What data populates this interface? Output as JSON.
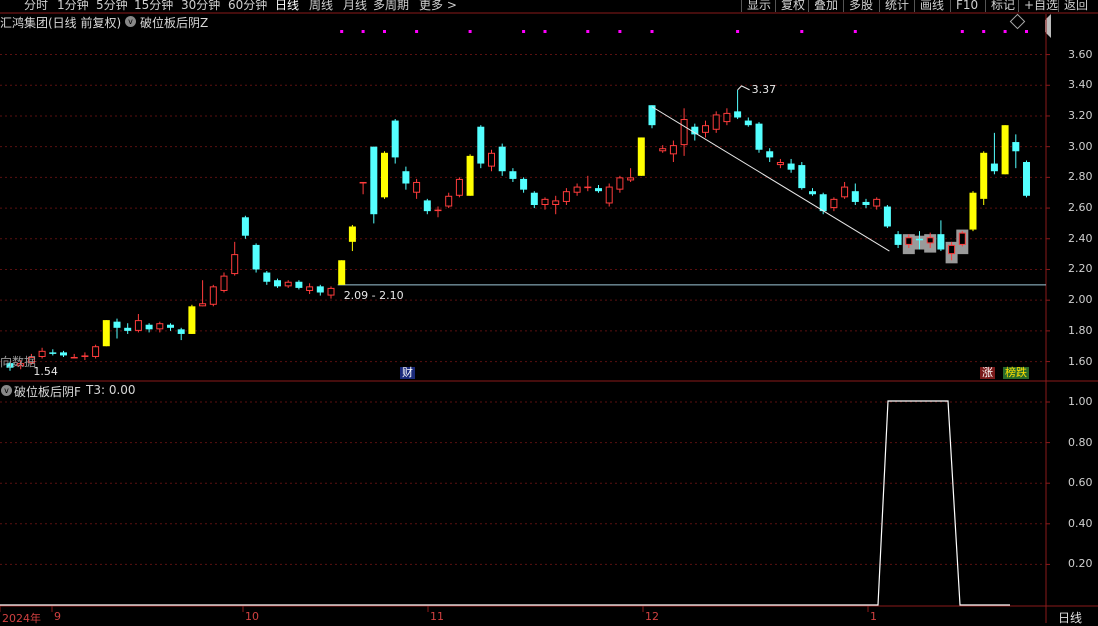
{
  "toolbar": {
    "left_items": [
      "分时",
      "1分钟",
      "5分钟",
      "15分钟",
      "30分钟",
      "60分钟",
      "日线",
      "周线",
      "月线",
      "多周期",
      "更多 >"
    ],
    "right_items": [
      "显示",
      "复权",
      "叠加",
      "多股",
      "统计",
      "画线",
      "F10",
      "标记",
      "+自选",
      "返回"
    ]
  },
  "main_header": {
    "title": "汇鸿集团(日线 前复权)",
    "indicator": "破位板后阴Z"
  },
  "sub_header": {
    "indicator_label": "破位板后阴F",
    "value_label": "T3: 0.00"
  },
  "annotations": {
    "high_label": "3.37",
    "low_label": "1.54",
    "gap_label": "2.09 - 2.10",
    "cai_badge": "财",
    "zhang_badge": "涨",
    "dieting_badge": "榜跌",
    "partial_text": "向数据"
  },
  "period_badge": "日线",
  "colors": {
    "up_candle": "#ff3c3c",
    "down_candle": "#54ffff",
    "signal_candle": "#ffff00",
    "marker": "#ff00ff",
    "axis_border": "#8a1a1a"
  },
  "chart_data": [
    {
      "type": "candlestick",
      "title": "汇鸿集团(日线 前复权)",
      "y_ticks": [
        "3.60",
        "3.40",
        "3.20",
        "3.00",
        "2.80",
        "2.60",
        "2.40",
        "2.20",
        "2.00",
        "1.80",
        "1.60"
      ],
      "ylim": [
        1.48,
        3.76
      ],
      "x_ticks": [
        "2024年",
        "9",
        "10",
        "11",
        "12",
        "1"
      ],
      "grid": true,
      "horizontal_line_value": 2.1,
      "trend_line": [
        [
          3.24,
          2.32
        ]
      ],
      "high_point": 3.37,
      "low_point": 1.54,
      "candles": [
        {
          "o": 1.59,
          "c": 1.56,
          "h": 1.6,
          "l": 1.54,
          "t": "down"
        },
        {
          "o": 1.57,
          "c": 1.59,
          "h": 1.61,
          "l": 1.55,
          "t": "up"
        },
        {
          "o": 1.59,
          "c": 1.63,
          "h": 1.65,
          "l": 1.58,
          "t": "up"
        },
        {
          "o": 1.63,
          "c": 1.67,
          "h": 1.69,
          "l": 1.62,
          "t": "up"
        },
        {
          "o": 1.66,
          "c": 1.65,
          "h": 1.68,
          "l": 1.64,
          "t": "down"
        },
        {
          "o": 1.66,
          "c": 1.64,
          "h": 1.67,
          "l": 1.63,
          "t": "down"
        },
        {
          "o": 1.63,
          "c": 1.63,
          "h": 1.65,
          "l": 1.62,
          "t": "up"
        },
        {
          "o": 1.63,
          "c": 1.64,
          "h": 1.66,
          "l": 1.61,
          "t": "up"
        },
        {
          "o": 1.63,
          "c": 1.7,
          "h": 1.71,
          "l": 1.62,
          "t": "up"
        },
        {
          "o": 1.7,
          "c": 1.87,
          "h": 1.87,
          "l": 1.7,
          "t": "signal"
        },
        {
          "o": 1.86,
          "c": 1.82,
          "h": 1.88,
          "l": 1.75,
          "t": "down"
        },
        {
          "o": 1.82,
          "c": 1.8,
          "h": 1.85,
          "l": 1.78,
          "t": "down"
        },
        {
          "o": 1.8,
          "c": 1.87,
          "h": 1.91,
          "l": 1.79,
          "t": "up"
        },
        {
          "o": 1.84,
          "c": 1.81,
          "h": 1.85,
          "l": 1.79,
          "t": "down"
        },
        {
          "o": 1.81,
          "c": 1.85,
          "h": 1.86,
          "l": 1.79,
          "t": "up"
        },
        {
          "o": 1.84,
          "c": 1.82,
          "h": 1.85,
          "l": 1.8,
          "t": "down"
        },
        {
          "o": 1.81,
          "c": 1.78,
          "h": 1.82,
          "l": 1.74,
          "t": "down"
        },
        {
          "o": 1.78,
          "c": 1.96,
          "h": 1.97,
          "l": 1.78,
          "t": "signal"
        },
        {
          "o": 1.96,
          "c": 1.98,
          "h": 2.13,
          "l": 1.96,
          "t": "up"
        },
        {
          "o": 1.97,
          "c": 2.09,
          "h": 2.1,
          "l": 1.96,
          "t": "up"
        },
        {
          "o": 2.06,
          "c": 2.16,
          "h": 2.18,
          "l": 2.05,
          "t": "up"
        },
        {
          "o": 2.17,
          "c": 2.3,
          "h": 2.38,
          "l": 2.16,
          "t": "up"
        },
        {
          "o": 2.42,
          "c": 2.54,
          "h": 2.55,
          "l": 2.4,
          "t": "down"
        },
        {
          "o": 2.36,
          "c": 2.2,
          "h": 2.37,
          "l": 2.18,
          "t": "down"
        },
        {
          "o": 2.18,
          "c": 2.12,
          "h": 2.19,
          "l": 2.1,
          "t": "down"
        },
        {
          "o": 2.13,
          "c": 2.09,
          "h": 2.14,
          "l": 2.08,
          "t": "down"
        },
        {
          "o": 2.09,
          "c": 2.12,
          "h": 2.13,
          "l": 2.08,
          "t": "up"
        },
        {
          "o": 2.12,
          "c": 2.08,
          "h": 2.13,
          "l": 2.07,
          "t": "down"
        },
        {
          "o": 2.06,
          "c": 2.09,
          "h": 2.11,
          "l": 2.04,
          "t": "up"
        },
        {
          "o": 2.09,
          "c": 2.05,
          "h": 2.1,
          "l": 2.03,
          "t": "down"
        },
        {
          "o": 2.03,
          "c": 2.08,
          "h": 2.09,
          "l": 2.01,
          "t": "up"
        },
        {
          "o": 2.1,
          "c": 2.26,
          "h": 2.26,
          "l": 2.1,
          "t": "signal"
        },
        {
          "o": 2.38,
          "c": 2.48,
          "h": 2.49,
          "l": 2.32,
          "t": "signal"
        },
        {
          "o": 2.77,
          "c": 2.77,
          "h": 2.77,
          "l": 2.69,
          "t": "up"
        },
        {
          "o": 2.56,
          "c": 3.0,
          "h": 3.0,
          "l": 2.5,
          "t": "down"
        },
        {
          "o": 2.67,
          "c": 2.96,
          "h": 2.97,
          "l": 2.66,
          "t": "signal"
        },
        {
          "o": 3.17,
          "c": 2.93,
          "h": 3.18,
          "l": 2.89,
          "t": "down"
        },
        {
          "o": 2.84,
          "c": 2.76,
          "h": 2.87,
          "l": 2.72,
          "t": "down"
        },
        {
          "o": 2.7,
          "c": 2.77,
          "h": 2.79,
          "l": 2.66,
          "t": "up"
        },
        {
          "o": 2.65,
          "c": 2.58,
          "h": 2.66,
          "l": 2.56,
          "t": "down"
        },
        {
          "o": 2.59,
          "c": 2.59,
          "h": 2.61,
          "l": 2.54,
          "t": "up"
        },
        {
          "o": 2.61,
          "c": 2.68,
          "h": 2.7,
          "l": 2.6,
          "t": "up"
        },
        {
          "o": 2.68,
          "c": 2.79,
          "h": 2.8,
          "l": 2.67,
          "t": "up"
        },
        {
          "o": 2.68,
          "c": 2.94,
          "h": 2.95,
          "l": 2.68,
          "t": "signal"
        },
        {
          "o": 3.13,
          "c": 2.89,
          "h": 3.14,
          "l": 2.86,
          "t": "down"
        },
        {
          "o": 2.87,
          "c": 2.96,
          "h": 2.98,
          "l": 2.84,
          "t": "up"
        },
        {
          "o": 3.0,
          "c": 2.84,
          "h": 3.02,
          "l": 2.81,
          "t": "down"
        },
        {
          "o": 2.84,
          "c": 2.79,
          "h": 2.86,
          "l": 2.77,
          "t": "down"
        },
        {
          "o": 2.79,
          "c": 2.72,
          "h": 2.8,
          "l": 2.7,
          "t": "down"
        },
        {
          "o": 2.7,
          "c": 2.62,
          "h": 2.71,
          "l": 2.6,
          "t": "down"
        },
        {
          "o": 2.62,
          "c": 2.66,
          "h": 2.67,
          "l": 2.59,
          "t": "up"
        },
        {
          "o": 2.62,
          "c": 2.65,
          "h": 2.68,
          "l": 2.56,
          "t": "up"
        },
        {
          "o": 2.64,
          "c": 2.71,
          "h": 2.73,
          "l": 2.62,
          "t": "up"
        },
        {
          "o": 2.7,
          "c": 2.74,
          "h": 2.76,
          "l": 2.68,
          "t": "up"
        },
        {
          "o": 2.73,
          "c": 2.74,
          "h": 2.81,
          "l": 2.71,
          "t": "up"
        },
        {
          "o": 2.71,
          "c": 2.73,
          "h": 2.75,
          "l": 2.7,
          "t": "down"
        },
        {
          "o": 2.63,
          "c": 2.74,
          "h": 2.76,
          "l": 2.61,
          "t": "up"
        },
        {
          "o": 2.72,
          "c": 2.8,
          "h": 2.81,
          "l": 2.7,
          "t": "up"
        },
        {
          "o": 2.78,
          "c": 2.8,
          "h": 2.86,
          "l": 2.77,
          "t": "up"
        },
        {
          "o": 2.81,
          "c": 3.06,
          "h": 3.06,
          "l": 2.81,
          "t": "signal"
        },
        {
          "o": 3.27,
          "c": 3.14,
          "h": 3.27,
          "l": 3.12,
          "t": "down"
        },
        {
          "o": 2.99,
          "c": 2.97,
          "h": 3.01,
          "l": 2.96,
          "t": "up"
        },
        {
          "o": 2.95,
          "c": 3.01,
          "h": 3.04,
          "l": 2.9,
          "t": "up"
        },
        {
          "o": 3.01,
          "c": 3.18,
          "h": 3.25,
          "l": 2.94,
          "t": "up"
        },
        {
          "o": 3.13,
          "c": 3.08,
          "h": 3.15,
          "l": 3.04,
          "t": "down"
        },
        {
          "o": 3.09,
          "c": 3.14,
          "h": 3.17,
          "l": 3.06,
          "t": "up"
        },
        {
          "o": 3.11,
          "c": 3.21,
          "h": 3.23,
          "l": 3.09,
          "t": "up"
        },
        {
          "o": 3.16,
          "c": 3.22,
          "h": 3.25,
          "l": 3.14,
          "t": "up"
        },
        {
          "o": 3.23,
          "c": 3.19,
          "h": 3.37,
          "l": 3.18,
          "t": "down"
        },
        {
          "o": 3.17,
          "c": 3.14,
          "h": 3.19,
          "l": 3.13,
          "t": "down"
        },
        {
          "o": 3.15,
          "c": 2.98,
          "h": 3.16,
          "l": 2.96,
          "t": "down"
        },
        {
          "o": 2.97,
          "c": 2.93,
          "h": 2.99,
          "l": 2.9,
          "t": "down"
        },
        {
          "o": 2.9,
          "c": 2.88,
          "h": 2.92,
          "l": 2.86,
          "t": "up"
        },
        {
          "o": 2.89,
          "c": 2.85,
          "h": 2.92,
          "l": 2.83,
          "t": "down"
        },
        {
          "o": 2.88,
          "c": 2.73,
          "h": 2.9,
          "l": 2.72,
          "t": "down"
        },
        {
          "o": 2.71,
          "c": 2.69,
          "h": 2.73,
          "l": 2.68,
          "t": "down"
        },
        {
          "o": 2.69,
          "c": 2.58,
          "h": 2.7,
          "l": 2.56,
          "t": "down"
        },
        {
          "o": 2.6,
          "c": 2.66,
          "h": 2.67,
          "l": 2.58,
          "t": "up"
        },
        {
          "o": 2.67,
          "c": 2.74,
          "h": 2.77,
          "l": 2.66,
          "t": "up"
        },
        {
          "o": 2.71,
          "c": 2.64,
          "h": 2.76,
          "l": 2.62,
          "t": "down"
        },
        {
          "o": 2.64,
          "c": 2.62,
          "h": 2.66,
          "l": 2.6,
          "t": "down"
        },
        {
          "o": 2.61,
          "c": 2.66,
          "h": 2.67,
          "l": 2.59,
          "t": "up"
        },
        {
          "o": 2.61,
          "c": 2.48,
          "h": 2.62,
          "l": 2.47,
          "t": "down"
        },
        {
          "o": 2.43,
          "c": 2.36,
          "h": 2.45,
          "l": 2.34,
          "t": "down"
        },
        {
          "o": 2.36,
          "c": 2.41,
          "h": 2.43,
          "l": 2.34,
          "t": "up"
        },
        {
          "o": 2.4,
          "c": 2.39,
          "h": 2.45,
          "l": 2.33,
          "t": "down"
        },
        {
          "o": 2.37,
          "c": 2.41,
          "h": 2.44,
          "l": 2.34,
          "t": "up"
        },
        {
          "o": 2.43,
          "c": 2.33,
          "h": 2.52,
          "l": 2.32,
          "t": "down"
        },
        {
          "o": 2.3,
          "c": 2.36,
          "h": 2.38,
          "l": 2.26,
          "t": "up"
        },
        {
          "o": 2.36,
          "c": 2.44,
          "h": 2.45,
          "l": 2.35,
          "t": "up"
        },
        {
          "o": 2.46,
          "c": 2.7,
          "h": 2.71,
          "l": 2.45,
          "t": "signal"
        },
        {
          "o": 2.66,
          "c": 2.96,
          "h": 2.97,
          "l": 2.62,
          "t": "signal"
        },
        {
          "o": 2.89,
          "c": 2.84,
          "h": 3.09,
          "l": 2.82,
          "t": "down"
        },
        {
          "o": 2.82,
          "c": 3.14,
          "h": 3.14,
          "l": 2.82,
          "t": "signal"
        },
        {
          "o": 3.03,
          "c": 2.97,
          "h": 3.08,
          "l": 2.86,
          "t": "down"
        },
        {
          "o": 2.9,
          "c": 2.68,
          "h": 2.91,
          "l": 2.67,
          "t": "down"
        }
      ],
      "gray_box_candles": [
        84,
        85,
        86,
        88,
        89
      ]
    },
    {
      "type": "line",
      "title": "破位板后阴F",
      "y_ticks": [
        "1.00",
        "0.80",
        "0.60",
        "0.40",
        "0.20"
      ],
      "ylim": [
        0,
        1.0
      ],
      "series": [
        {
          "name": "T3",
          "values_note": "step",
          "points": [
            [
              0,
              0
            ],
            [
              79,
              0
            ],
            [
              80,
              1
            ],
            [
              85,
              1
            ],
            [
              86,
              0
            ],
            [
              90,
              0
            ]
          ]
        }
      ]
    }
  ]
}
